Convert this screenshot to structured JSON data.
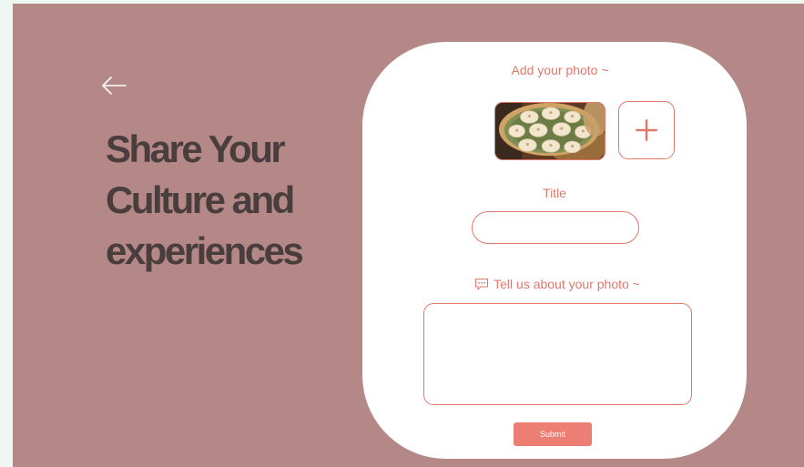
{
  "page": {
    "heading": "Share Your Culture and experiences",
    "back_icon": "arrow-left-icon"
  },
  "form": {
    "photo_label": "Add your photo ~",
    "photo_thumbnail_icon": "dumplings-photo",
    "add_photo_icon": "plus-icon",
    "title_label": "Title",
    "title_value": "",
    "about_icon": "chat-bubble-icon",
    "about_label": "Tell us about your photo ~",
    "about_value": "",
    "submit_label": "Submit"
  },
  "colors": {
    "background": "#b48887",
    "card": "#ffffff",
    "accent": "#e0786b",
    "button": "#ec7e74",
    "heading": "#4a3d3d"
  }
}
